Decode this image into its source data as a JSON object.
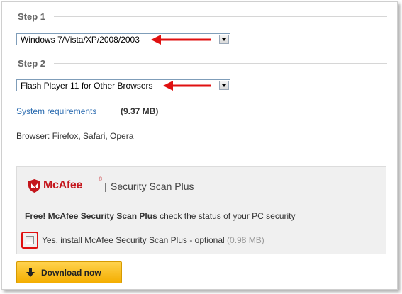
{
  "step1": {
    "heading": "Step 1",
    "os_select_value": "Windows 7/Vista/XP/2008/2003"
  },
  "step2": {
    "heading": "Step 2",
    "player_select_value": "Flash Player 11 for Other Browsers"
  },
  "info": {
    "system_requirements_link": "System requirements",
    "file_size": "(9.37 MB)",
    "browsers": "Browser: Firefox, Safari, Opera"
  },
  "offer": {
    "brand": "McAfee",
    "registered_mark": "®",
    "separator": "|",
    "product": "Security Scan Plus",
    "promo_bold": "Free! McAfee Security Scan Plus",
    "promo_rest": " check the status of your PC security",
    "checkbox_label": "Yes, install McAfee Security Scan Plus - optional ",
    "checkbox_size": "(0.98 MB)",
    "checkbox_checked": false
  },
  "download_button": {
    "label": "Download now",
    "icon": "down-arrow-icon"
  },
  "colors": {
    "annotation_red": "#e01010",
    "link_blue": "#2a6bb0",
    "mcafee_red": "#c4161c",
    "download_gold": "#f4ae00"
  }
}
